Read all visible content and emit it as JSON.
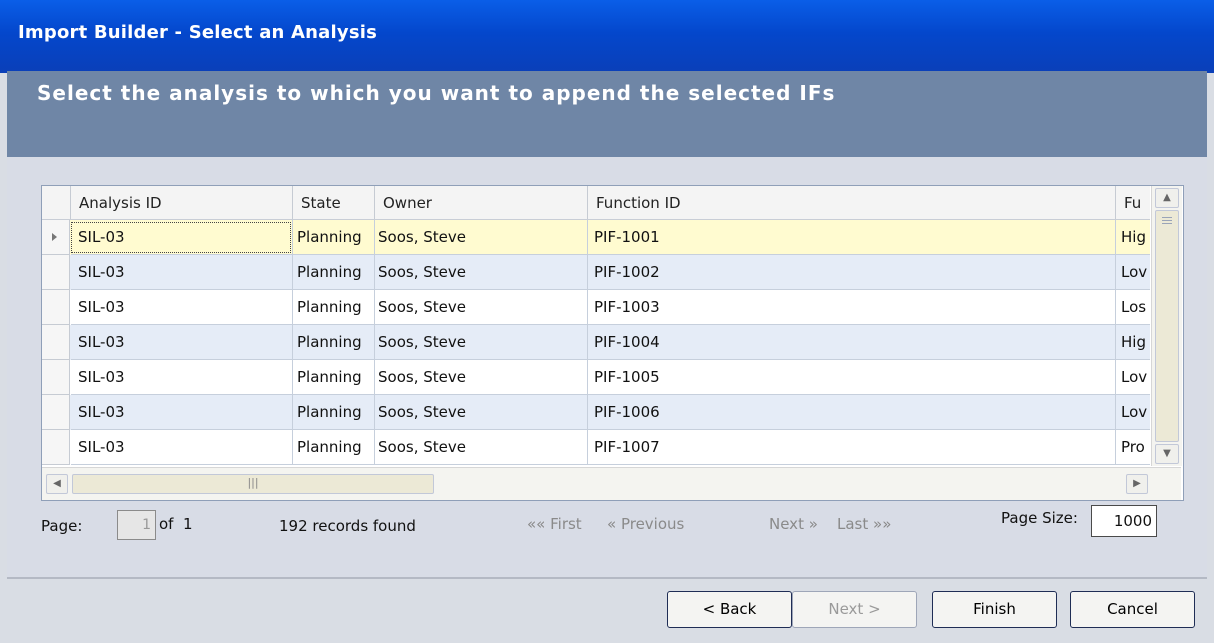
{
  "window": {
    "title": "Import Builder - Select an Analysis"
  },
  "header": {
    "instruction": "Select the analysis to which you want to append the selected IFs"
  },
  "grid": {
    "columns": [
      "Analysis ID",
      "State",
      "Owner",
      "Function ID",
      "Fu"
    ],
    "rows": [
      {
        "analysis_id": "SIL-03",
        "state": "Planning",
        "owner": "Soos, Steve",
        "function_id": "PIF-1001",
        "fu": "Hig",
        "selected": true
      },
      {
        "analysis_id": "SIL-03",
        "state": "Planning",
        "owner": "Soos, Steve",
        "function_id": "PIF-1002",
        "fu": "Lov"
      },
      {
        "analysis_id": "SIL-03",
        "state": "Planning",
        "owner": "Soos, Steve",
        "function_id": "PIF-1003",
        "fu": "Los"
      },
      {
        "analysis_id": "SIL-03",
        "state": "Planning",
        "owner": "Soos, Steve",
        "function_id": "PIF-1004",
        "fu": "Hig"
      },
      {
        "analysis_id": "SIL-03",
        "state": "Planning",
        "owner": "Soos, Steve",
        "function_id": "PIF-1005",
        "fu": "Lov"
      },
      {
        "analysis_id": "SIL-03",
        "state": "Planning",
        "owner": "Soos, Steve",
        "function_id": "PIF-1006",
        "fu": "Lov"
      },
      {
        "analysis_id": "SIL-03",
        "state": "Planning",
        "owner": "Soos, Steve",
        "function_id": "PIF-1007",
        "fu": "Pro"
      }
    ]
  },
  "pager": {
    "page_label": "Page:",
    "page_value": "1",
    "of_label": "of",
    "total_pages": "1",
    "records": "192 records found",
    "first": "«« First",
    "previous": "« Previous",
    "next": "Next »",
    "last": "Last »»",
    "page_size_label": "Page Size:",
    "page_size_value": "1000"
  },
  "footer": {
    "back": "< Back",
    "next": "Next >",
    "finish": "Finish",
    "cancel": "Cancel"
  },
  "colors": {
    "titlebar": "#0a4fd8",
    "header": "#6f86a6",
    "selected_row": "#fffbd0",
    "alt_row": "#e5ecf7"
  }
}
